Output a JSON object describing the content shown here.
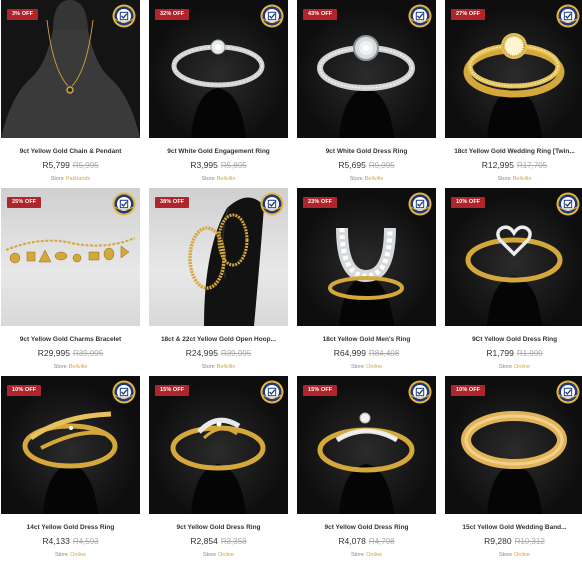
{
  "products": [
    {
      "badge": "3% OFF",
      "title": "9ct Yellow Gold Chain & Pendant",
      "price": "R5,799",
      "was": "R5,995",
      "store_label": "Store",
      "store": "Parklands",
      "bg": "bust",
      "icon": "chain-pendant-image"
    },
    {
      "badge": "32% OFF",
      "title": "9ct White Gold Engagement Ring",
      "price": "R3,995",
      "was": "R5,895",
      "store_label": "Store",
      "store": "Bellville",
      "bg": "dark",
      "icon": "engagement-ring-image"
    },
    {
      "badge": "43% OFF",
      "title": "9ct White Gold Dress Ring",
      "price": "R5,695",
      "was": "R9,995",
      "store_label": "Store",
      "store": "Bellville",
      "bg": "dark",
      "icon": "dress-ring-image"
    },
    {
      "badge": "27% OFF",
      "title": "18ct Yellow Gold Wedding Ring [Twin...",
      "price": "R12,995",
      "was": "R17,705",
      "store_label": "Store",
      "store": "Bellville",
      "bg": "dark",
      "icon": "wedding-ring-twin-image"
    },
    {
      "badge": "25% OFF",
      "title": "9ct Yellow Gold Charms Bracelet",
      "price": "R29,995",
      "was": "R39,995",
      "store_label": "Store",
      "store": "Bellville",
      "bg": "light",
      "icon": "charms-bracelet-image"
    },
    {
      "badge": "38% OFF",
      "title": "18ct & 22ct Yellow Gold Open Hoop...",
      "price": "R24,995",
      "was": "R39,995",
      "store_label": "Store",
      "store": "Bellville",
      "bg": "light",
      "icon": "hoop-earrings-image"
    },
    {
      "badge": "23% OFF",
      "title": "18ct Yellow Gold Men's Ring",
      "price": "R64,999",
      "was": "R84,408",
      "store_label": "Store",
      "store": "Online",
      "bg": "dark",
      "icon": "horseshoe-ring-image"
    },
    {
      "badge": "10% OFF",
      "title": "9Ct Yellow Gold Dress Ring",
      "price": "R1,799",
      "was": "R1,999",
      "store_label": "Store",
      "store": "Online",
      "bg": "dark",
      "icon": "heart-ring-image"
    },
    {
      "badge": "10% OFF",
      "title": "14ct Yellow Gold Dress Ring",
      "price": "R4,133",
      "was": "R4,593",
      "store_label": "Store",
      "store": "Online",
      "bg": "dark",
      "icon": "twist-ring-image"
    },
    {
      "badge": "15% OFF",
      "title": "9ct Yellow Gold Dress Ring",
      "price": "R2,854",
      "was": "R3,358",
      "store_label": "Store",
      "store": "Online",
      "bg": "dark",
      "icon": "swirl-ring-image"
    },
    {
      "badge": "15% OFF",
      "title": "9ct Yellow Gold Dress Ring",
      "price": "R4,078",
      "was": "R4,798",
      "store_label": "Store",
      "store": "Online",
      "bg": "dark",
      "icon": "solitaire-swirl-ring-image"
    },
    {
      "badge": "10% OFF",
      "title": "15ct Yellow Gold Wedding Band...",
      "price": "R9,280",
      "was": "R10,312",
      "store_label": "Store",
      "store": "Online",
      "bg": "dark",
      "icon": "wedding-band-image"
    }
  ],
  "colors": {
    "badge": "#b0242c",
    "gold": "#d4a83a",
    "silver": "#cfd3d6",
    "store_name": "#d9a441"
  }
}
